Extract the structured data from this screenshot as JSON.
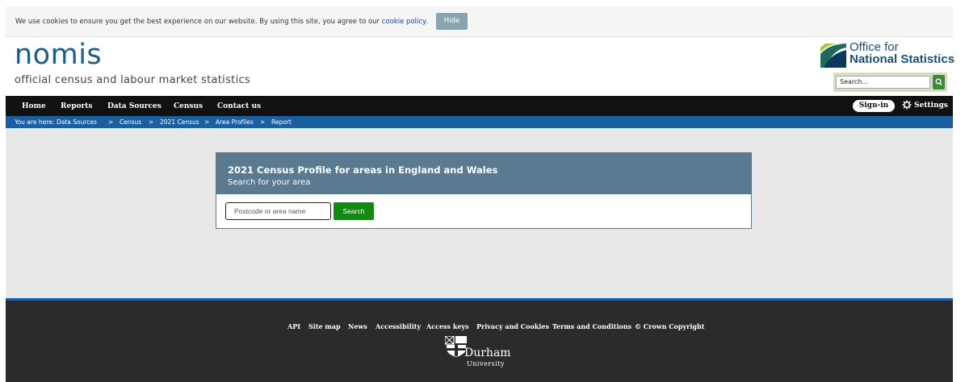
{
  "cookie": {
    "message": "We use cookies to ensure you get the best experience on our website. By using this site, you agree to our",
    "link": "cookie policy.",
    "hide": "Hide"
  },
  "header": {
    "logo": "nomis",
    "tagline": "official census and labour market statistics",
    "ons_line1": "Office for",
    "ons_line2": "National Statistics",
    "search_value": "Search..."
  },
  "nav": {
    "items": [
      "Home",
      "Reports",
      "Data Sources",
      "Census",
      "Contact us"
    ],
    "signin": "Sign-in",
    "settings": "Settings"
  },
  "breadcrumb": {
    "prefix": "You are here:",
    "items": [
      "Data Sources",
      "Census",
      "2021 Census",
      "Area Profiles",
      "Report"
    ],
    "separator": ">"
  },
  "panel": {
    "title": "2021 Census Profile for areas in England and Wales",
    "subtitle": "Search for your area",
    "input_placeholder": "Postcode or area name",
    "button": "Search"
  },
  "footer": {
    "links": [
      "API",
      "Site map",
      "News",
      "Accessibility",
      "Access keys",
      "Privacy and Cookies",
      "Terms and Conditions",
      "© Crown Copyright"
    ],
    "durham_name": "Durham",
    "durham_sub": "University"
  },
  "colors": {
    "brand_blue": "#1a5c8c",
    "nav_bg": "#111111",
    "breadcrumb_bg": "#1a5fa0",
    "panel_head": "#5a7a92",
    "search_green": "#128a12",
    "footer_bg": "#2b2b2b"
  }
}
